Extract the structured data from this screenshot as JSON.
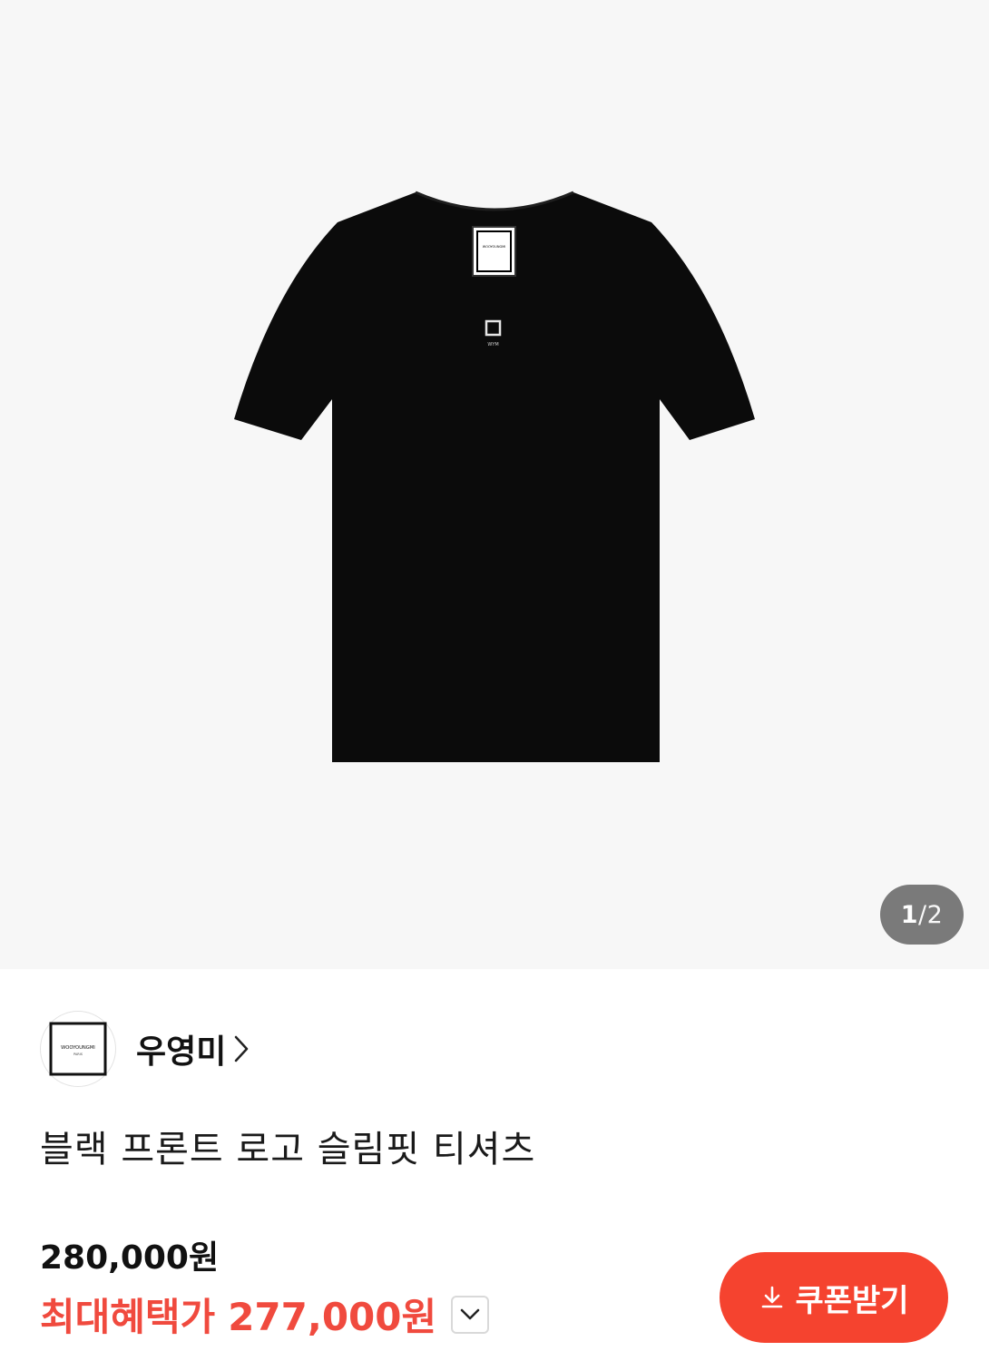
{
  "gallery": {
    "image_alt": "블랙 프론트 로고 슬림핏 티셔츠",
    "current_page": "1",
    "separator": "/",
    "total_pages": "2"
  },
  "product": {
    "brand_name": "우영미",
    "brand_logo_text": "WOOYOUNGMI",
    "brand_logo_subtext": "PARIS",
    "chest_logo_text": "WYM",
    "title": "블랙 프론트 로고 슬림핏 티셔츠",
    "original_price": "280,000원",
    "benefit_label": "최대혜택가",
    "benefit_price": "277,000원"
  },
  "actions": {
    "coupon_label": "쿠폰받기"
  },
  "colors": {
    "accent": "#f04a3e",
    "coupon_bg": "#f5432f",
    "gallery_bg": "#f7f7f7",
    "indicator_bg": "#7a7a7a"
  }
}
